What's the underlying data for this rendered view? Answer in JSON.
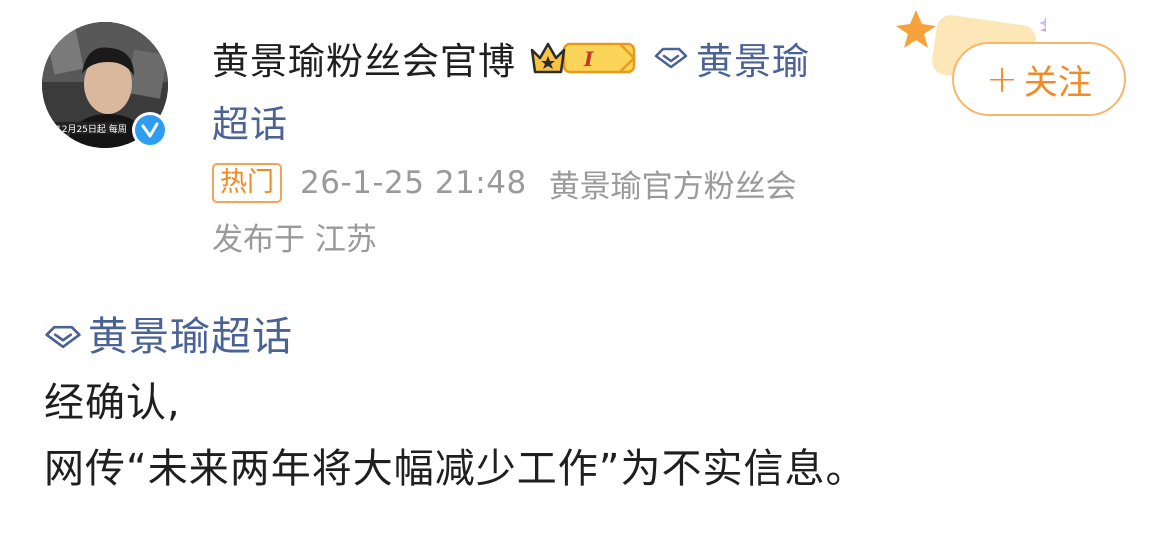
{
  "post_header": {
    "user_name": "黄景瑜粉丝会官博",
    "crown_badge_level": "I",
    "topic_link_line1": "黄景瑜",
    "topic_link_line2": "超话",
    "follow_button": {
      "plus": "+",
      "label": "关注"
    },
    "hot_badge": "热门",
    "timestamp": "26-1-25 21:48",
    "source": "黄景瑜官方粉丝会",
    "location": "发布于 江苏",
    "avatar_caption": "12月25日起 每周"
  },
  "post_body": {
    "topic_tag": "黄景瑜超话",
    "line1": "经确认,",
    "line2": "网传“未来两年将大幅减少工作”为不实信息。"
  },
  "colors": {
    "topic_blue": "#4a6294",
    "follow_orange": "#f08c28",
    "verified_blue": "#2e9cf0",
    "meta_gray": "#9a9a9a"
  }
}
